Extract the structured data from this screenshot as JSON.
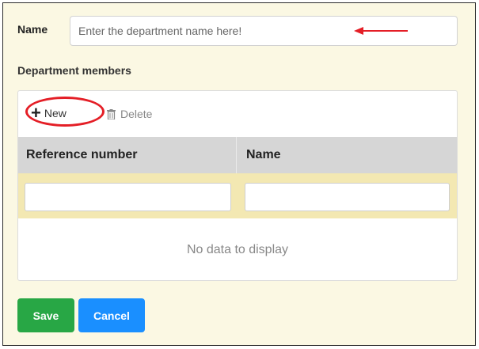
{
  "form": {
    "name_label": "Name",
    "name_placeholder": "Enter the department name here!",
    "members_label": "Department members"
  },
  "grid": {
    "toolbar": {
      "new_label": "New",
      "delete_label": "Delete"
    },
    "columns": [
      "Reference number",
      "Name"
    ],
    "empty_message": "No data to display"
  },
  "actions": {
    "save_label": "Save",
    "cancel_label": "Cancel"
  },
  "colors": {
    "panel_bg": "#fbf8e3",
    "filter_row_bg": "#f3e8b2",
    "header_bg": "#d6d6d6",
    "save_bg": "#28a745",
    "cancel_bg": "#1a8fff",
    "annotation": "#e41e26"
  },
  "icons": {
    "new": "plus-icon",
    "delete": "trash-icon",
    "annotation_arrow": "left-arrow-icon"
  }
}
